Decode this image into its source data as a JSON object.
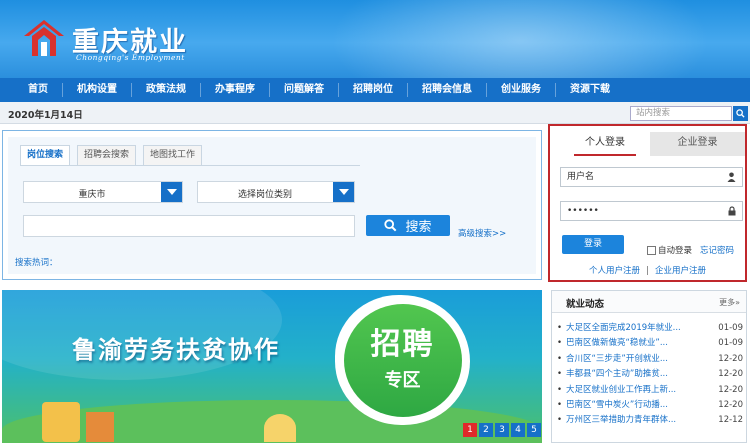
{
  "header": {
    "site_name": "重庆就业",
    "site_subtitle": "Chongqing's Employment"
  },
  "nav": {
    "items": [
      "首页",
      "机构设置",
      "政策法规",
      "办事程序",
      "问题解答",
      "招聘岗位",
      "招聘会信息",
      "创业服务",
      "资源下载"
    ]
  },
  "datebar": {
    "date": "2020年1月14日",
    "site_search_placeholder": "站内搜索"
  },
  "job_search": {
    "tabs": [
      "岗位搜索",
      "招聘会搜索",
      "地图找工作"
    ],
    "city_select": "重庆市",
    "category_select": "选择岗位类别",
    "keyword_value": "",
    "search_button": "搜索",
    "advanced_link": "高级搜索>>",
    "hot_label": "搜索热词："
  },
  "login": {
    "tab_personal": "个人登录",
    "tab_company": "企业登录",
    "username_value": "用户名",
    "password_value": "••••••",
    "login_button": "登录",
    "auto_login": "自动登录",
    "forgot_password": "忘记密码",
    "register_personal": "个人用户注册",
    "register_separator": "|",
    "register_company": "企业用户注册"
  },
  "banner": {
    "headline": "鲁渝劳务扶贫协作",
    "badge_main": "招聘",
    "badge_sub": "专区",
    "pages": [
      "1",
      "2",
      "3",
      "4",
      "5"
    ],
    "active_page": "1"
  },
  "news": {
    "title": "就业动态",
    "more": "更多»",
    "items": [
      {
        "title": "大足区全面完成2019年就业...",
        "date": "01-09"
      },
      {
        "title": "巴南区做新做亮“稳就业”...",
        "date": "01-09"
      },
      {
        "title": "合川区“三步走”开创就业...",
        "date": "12-20"
      },
      {
        "title": "丰都县“四个主动”助推贫...",
        "date": "12-20"
      },
      {
        "title": "大足区就业创业工作再上新...",
        "date": "12-20"
      },
      {
        "title": "巴南区“雪中炭火”行动播...",
        "date": "12-20"
      },
      {
        "title": "万州区三举措助力青年群体...",
        "date": "12-12"
      }
    ]
  },
  "colors": {
    "brand_blue": "#1670c8",
    "highlight_red": "#c0282c",
    "button_blue": "#1c84dc"
  }
}
